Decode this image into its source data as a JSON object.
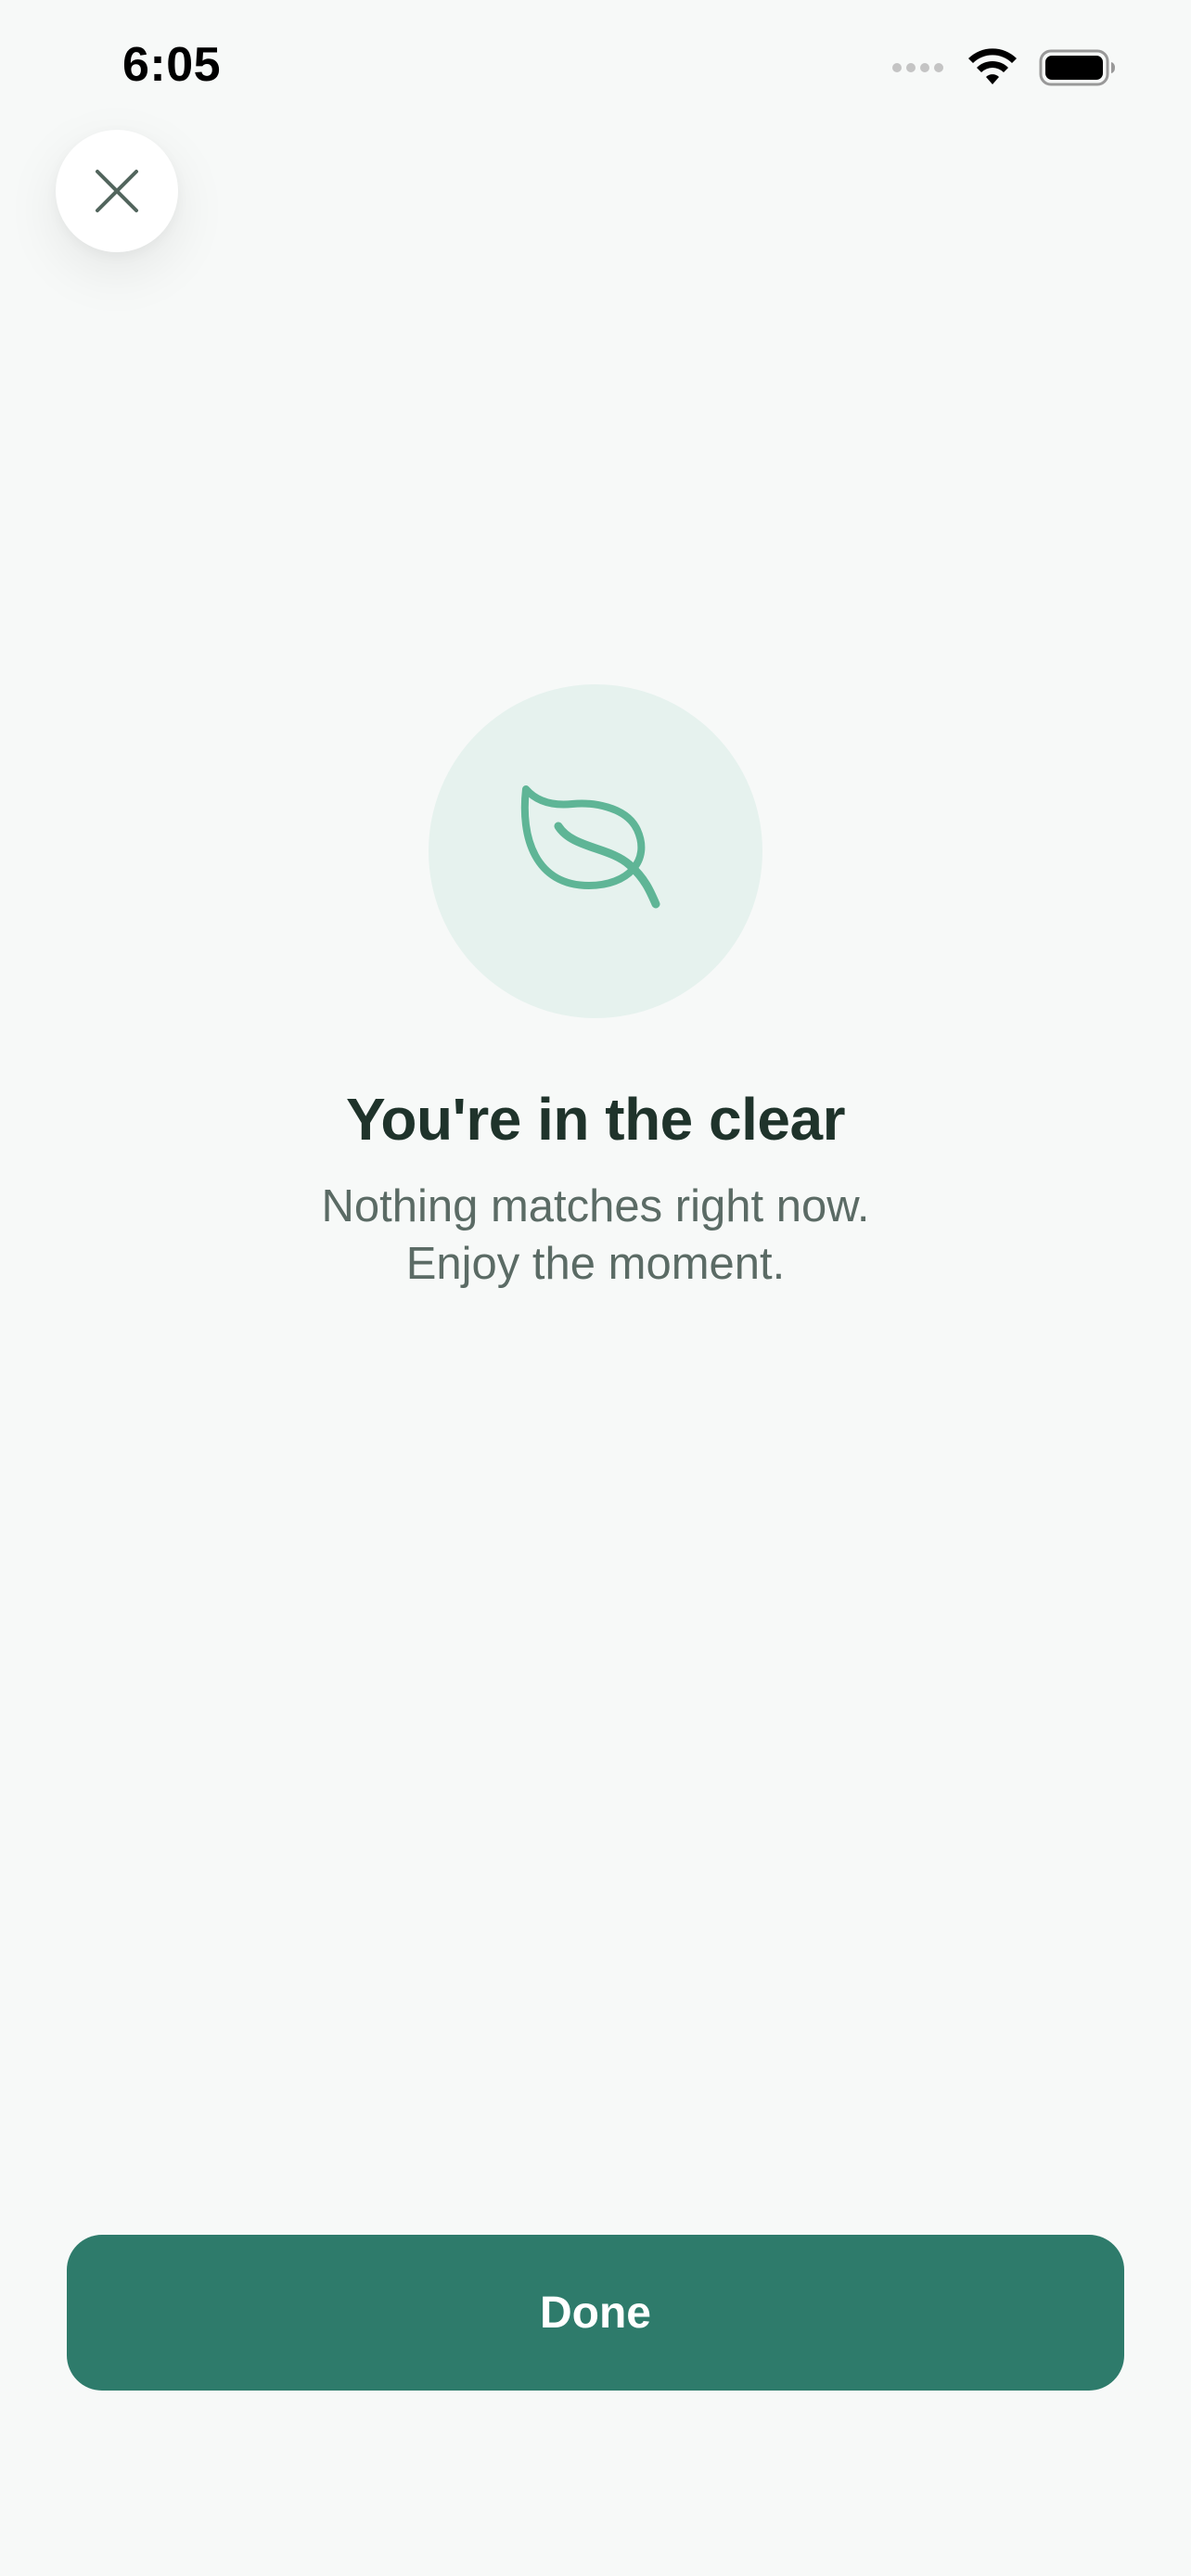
{
  "status_bar": {
    "time": "6:05",
    "icons": [
      "signal-icon",
      "wifi-icon",
      "battery-icon"
    ]
  },
  "close_button": {
    "icon": "close-icon"
  },
  "empty_state": {
    "icon": "leaf-icon",
    "title": "You're in the clear",
    "subtitle_lines": [
      "Nothing matches right now.",
      "Enjoy the moment."
    ]
  },
  "footer": {
    "done_label": "Done"
  },
  "colors": {
    "background": "#f7f9f8",
    "accent": "#2e7b6b",
    "leaf": "#5fb596",
    "leaf_circle": "#e6f2ee",
    "title": "#1f332b",
    "subtitle": "#5b6b65"
  }
}
